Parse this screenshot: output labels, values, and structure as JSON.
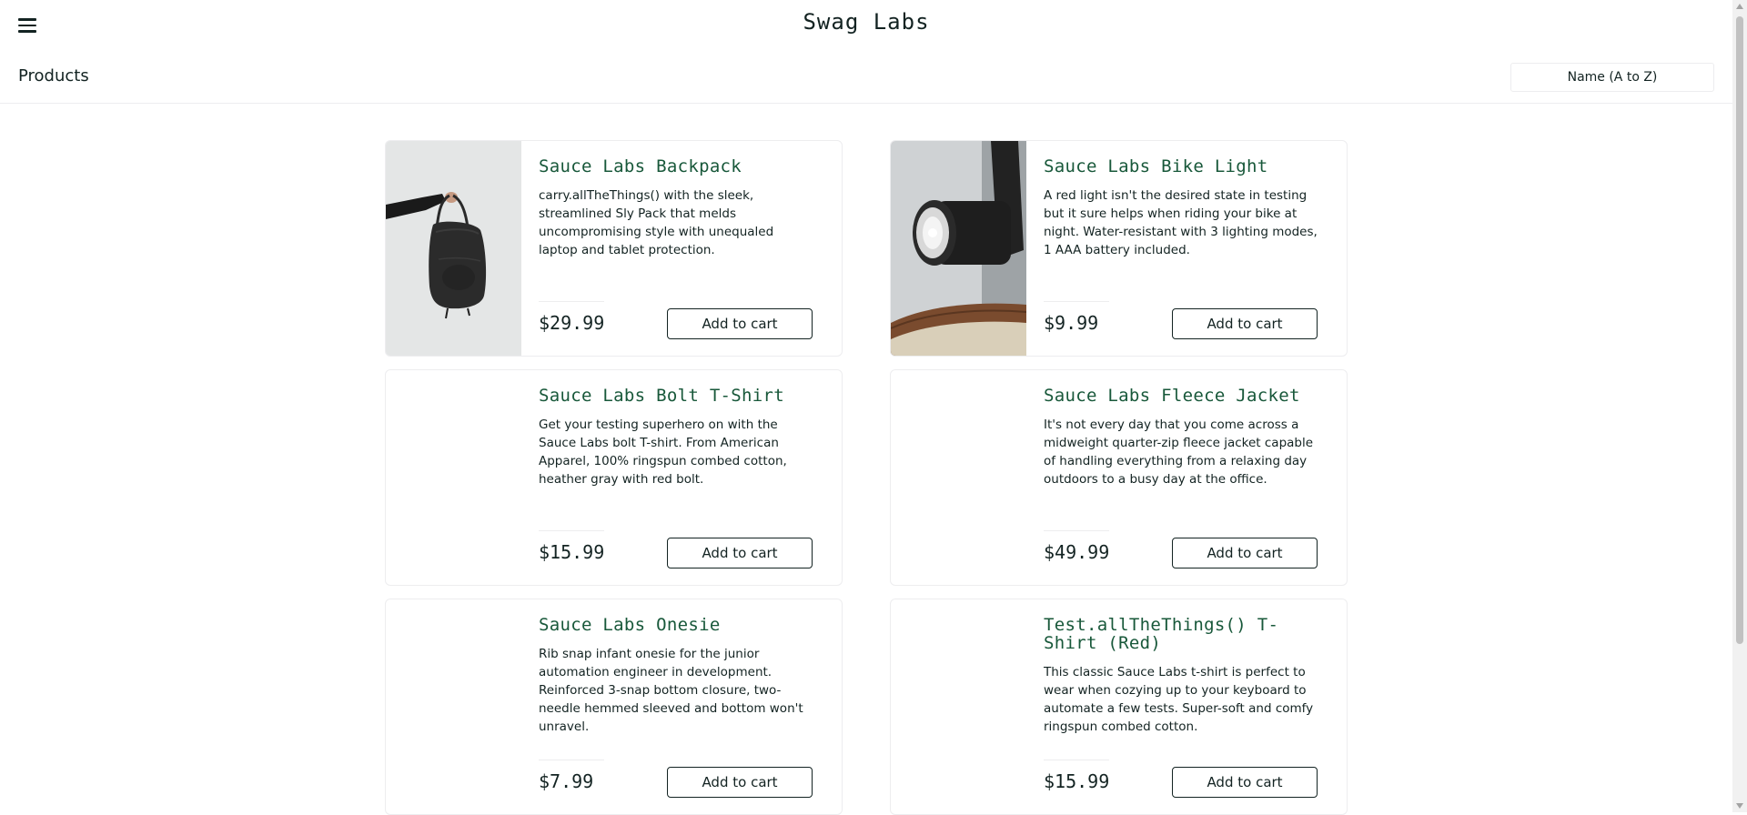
{
  "header": {
    "app_title": "Swag Labs",
    "menu_icon": "hamburger-menu-icon"
  },
  "secondary_header": {
    "title": "Products",
    "sort_selected": "Name (A to Z)"
  },
  "colors": {
    "item_name": "#18583a",
    "text": "#132322",
    "border": "#ededef"
  },
  "products": [
    {
      "name": "Sauce Labs Backpack",
      "description": "carry.allTheThings() with the sleek, streamlined Sly Pack that melds uncompromising style with unequaled laptop and tablet protection.",
      "price": "$29.99",
      "button": "Add to cart",
      "image": "backpack"
    },
    {
      "name": "Sauce Labs Bike Light",
      "description": "A red light isn't the desired state in testing but it sure helps when riding your bike at night. Water-resistant with 3 lighting modes, 1 AAA battery included.",
      "price": "$9.99",
      "button": "Add to cart",
      "image": "bike-light"
    },
    {
      "name": "Sauce Labs Bolt T-Shirt",
      "description": "Get your testing superhero on with the Sauce Labs bolt T-shirt. From American Apparel, 100% ringspun combed cotton, heather gray with red bolt.",
      "price": "$15.99",
      "button": "Add to cart",
      "image": ""
    },
    {
      "name": "Sauce Labs Fleece Jacket",
      "description": "It's not every day that you come across a midweight quarter-zip fleece jacket capable of handling everything from a relaxing day outdoors to a busy day at the office.",
      "price": "$49.99",
      "button": "Add to cart",
      "image": ""
    },
    {
      "name": "Sauce Labs Onesie",
      "description": "Rib snap infant onesie for the junior automation engineer in development. Reinforced 3-snap bottom closure, two-needle hemmed sleeved and bottom won't unravel.",
      "price": "$7.99",
      "button": "Add to cart",
      "image": ""
    },
    {
      "name": "Test.allTheThings() T-Shirt (Red)",
      "description": "This classic Sauce Labs t-shirt is perfect to wear when cozying up to your keyboard to automate a few tests. Super-soft and comfy ringspun combed cotton.",
      "price": "$15.99",
      "button": "Add to cart",
      "image": ""
    }
  ]
}
